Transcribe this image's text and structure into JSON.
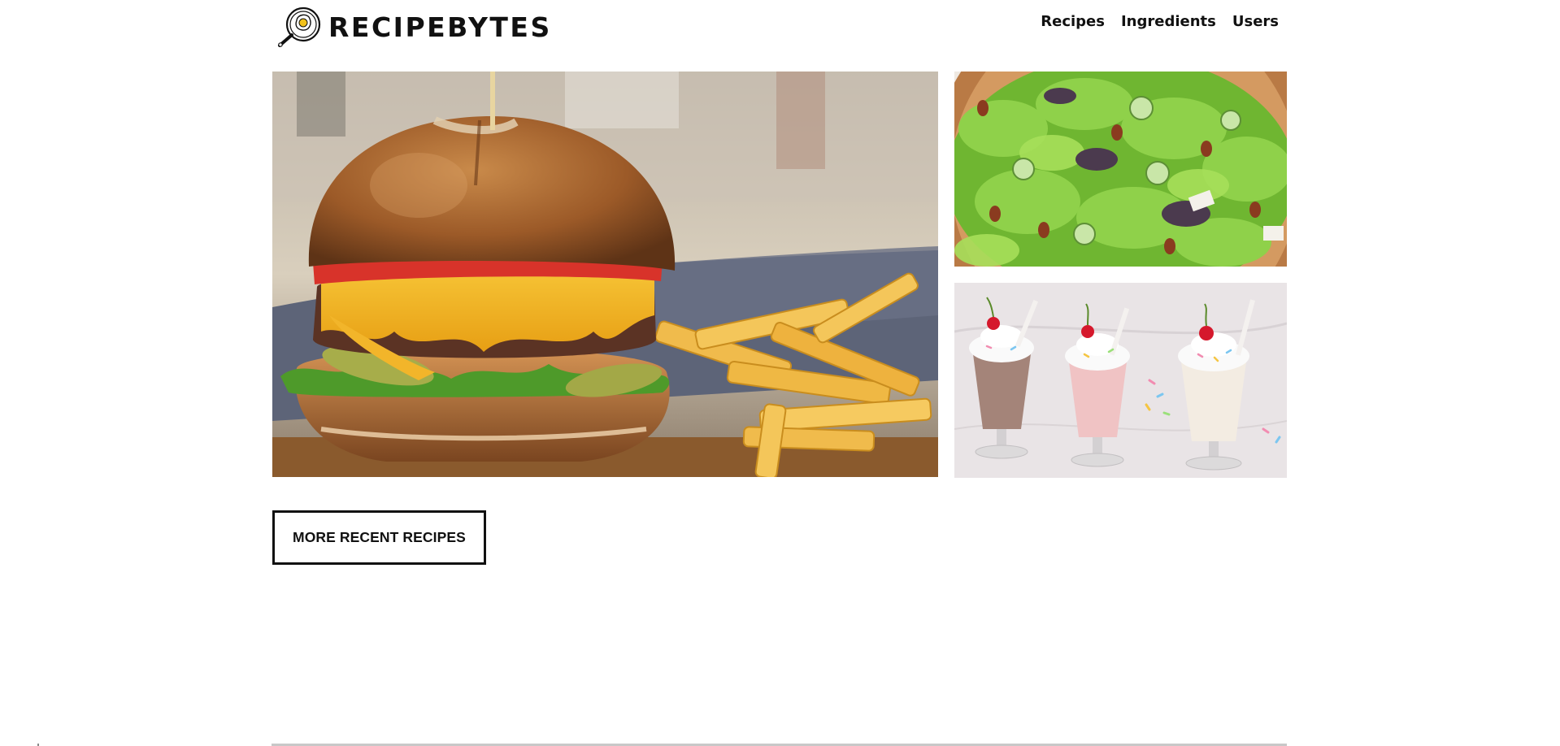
{
  "brand": {
    "name": "RECIPEBYTES",
    "logo_icon": "frying-pan-egg-icon"
  },
  "nav": {
    "items": [
      {
        "label": "Recipes"
      },
      {
        "label": "Ingredients"
      },
      {
        "label": "Users"
      }
    ]
  },
  "featured": {
    "tiles": [
      {
        "subject": "burger-and-fries-photo"
      },
      {
        "subject": "green-salad-photo"
      },
      {
        "subject": "milkshakes-photo"
      }
    ]
  },
  "actions": {
    "more_recent_label": "MORE RECENT RECIPES"
  },
  "colors": {
    "text": "#111111",
    "background": "#ffffff",
    "button_border": "#111111"
  }
}
